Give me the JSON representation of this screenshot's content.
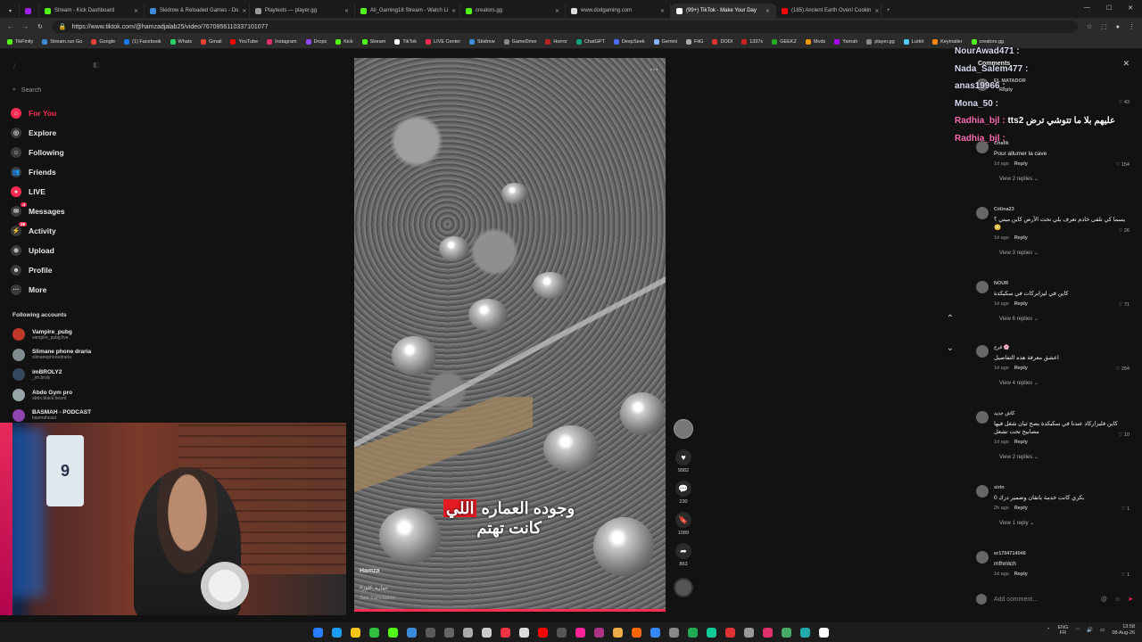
{
  "browser": {
    "tabs": [
      {
        "title": "Stream - Kick Dashboard",
        "color": "#53fc18",
        "active": false
      },
      {
        "title": "Skidrow & Reloaded Games - Do",
        "color": "#3b8bd9",
        "active": false
      },
      {
        "title": "Playtests — player.gg",
        "color": "#999999",
        "active": false
      },
      {
        "title": "Ali_Gaming18 Stream - Watch Li",
        "color": "#53fc18",
        "active": false
      },
      {
        "title": "creators.gg",
        "color": "#53fc18",
        "active": false
      },
      {
        "title": "www.dodgaming.com",
        "color": "#dddddd",
        "active": false
      },
      {
        "title": "(99+) TikTok - Make Your Day",
        "color": "#ffffff",
        "active": true
      },
      {
        "title": "(185) Ancient Earth Oven! Cookin",
        "color": "#ff0000",
        "active": false
      }
    ],
    "url": "https://www.tiktok.com/@hamzadjalab25/video/7670956110337101077",
    "bookmarks": [
      "TikFinity",
      "Stream.run Go",
      "Google",
      "(1) Facebook",
      "Whats",
      "Gmail",
      "YouTube",
      "Instagram",
      "Drops",
      "Kick",
      "Stream",
      "TikTok",
      "LIVE Center",
      "Skidrow",
      "GameDrive",
      "Horror",
      "ChatGPT",
      "DeepSeek",
      "Gemini",
      "FitG",
      "DODI",
      "1337x",
      "GEEKZ",
      "Mods",
      "Yamah",
      "player.gg",
      "Lurkit",
      "Keymailer",
      "creators.gg"
    ],
    "window_controls": [
      "—",
      "☐",
      "✕"
    ]
  },
  "sidebar": {
    "search_placeholder": "Search",
    "nav": [
      {
        "label": "For You",
        "icon": "home-icon",
        "glyph": "⌂",
        "active": true,
        "badge": ""
      },
      {
        "label": "Explore",
        "icon": "compass-icon",
        "glyph": "◎",
        "active": false,
        "badge": ""
      },
      {
        "label": "Following",
        "icon": "following-icon",
        "glyph": "☺",
        "active": false,
        "badge": ""
      },
      {
        "label": "Friends",
        "icon": "friends-icon",
        "glyph": "👥",
        "active": false,
        "badge": ""
      },
      {
        "label": "LIVE",
        "icon": "live-icon",
        "glyph": "●",
        "active": false,
        "badge": ""
      },
      {
        "label": "Messages",
        "icon": "messages-icon",
        "glyph": "✉",
        "active": false,
        "badge": "4"
      },
      {
        "label": "Activity",
        "icon": "activity-icon",
        "glyph": "⚡",
        "active": false,
        "badge": "28"
      },
      {
        "label": "Upload",
        "icon": "upload-icon",
        "glyph": "⊕",
        "active": false,
        "badge": ""
      },
      {
        "label": "Profile",
        "icon": "profile-icon",
        "glyph": "☻",
        "active": false,
        "badge": ""
      },
      {
        "label": "More",
        "icon": "more-icon",
        "glyph": "···",
        "active": false,
        "badge": ""
      }
    ],
    "following_title": "Following accounts",
    "following": [
      {
        "name": "Vampire_pubg",
        "handle": "vampire_pubg.live"
      },
      {
        "name": "Slimane phone draria",
        "handle": "slimanephonedraria"
      },
      {
        "name": "imBROLY2",
        "handle": "_im.broly"
      },
      {
        "name": "Abdo Gym pro",
        "handle": "abdo.black.beard"
      },
      {
        "name": "BASMAH - PODCAST",
        "handle": "basmahcast"
      }
    ]
  },
  "video": {
    "caption_line1_plain": "وجوده العماره",
    "caption_line1_highlight": "اللي",
    "caption_line2": "كانت تهتم",
    "author": "Hamza",
    "tag": "#عمارة_كلوز",
    "see_translation": "See translation",
    "progress": 1.0
  },
  "actions": {
    "likes": "9982",
    "comments": "230",
    "saves": "1089",
    "shares": "863"
  },
  "comments": {
    "title": "Comments",
    "items": [
      {
        "user": "EL MATADOR",
        "text": "",
        "time": "",
        "reply": "Reply",
        "likes": "43",
        "more": ""
      },
      {
        "user": "Chafik",
        "text": "Pour allumer la cave",
        "time": "1d ago",
        "reply": "Reply",
        "likes": "154",
        "more": "View 2 replies"
      },
      {
        "user": "Célina23",
        "text": "يسما كي تلقى خادم تعرف بلي تحت الأرض كاين مبني ؟ 😳",
        "time": "1d ago",
        "reply": "Reply",
        "likes": "26",
        "more": "View 3 replies"
      },
      {
        "user": "NOUR",
        "text": "كاين في ليزابركات في سكيكدة",
        "time": "1d ago",
        "reply": "Reply",
        "likes": "71",
        "more": "View 6 replies"
      },
      {
        "user": "فرح 🌸",
        "text": "اعشق معرفة هذه التفاصيل",
        "time": "1d ago",
        "reply": "Reply",
        "likes": "284",
        "more": "View 4 replies"
      },
      {
        "user": "كاش جديد",
        "text": "كاين فليزاركاد عندنا في سكيكدة بصح ثيان شغل فيها مصابيح تحت تشعل",
        "time": "1d ago",
        "reply": "Reply",
        "likes": "10",
        "more": "View 2 replies"
      },
      {
        "user": "sirin",
        "text": "بكري كانت خدمة باتقان وضمير دزك 0",
        "time": "2h ago",
        "reply": "Reply",
        "likes": "1",
        "more": "View 1 reply"
      },
      {
        "user": "er1704714046",
        "text": "mfhmtch",
        "time": "1d ago",
        "reply": "Reply",
        "likes": "1",
        "more": ""
      }
    ],
    "input_placeholder": "Add comment..."
  },
  "stream_chat": [
    {
      "user": "NourAwad471",
      "msg": "",
      "color": "#d8dcf0"
    },
    {
      "user": "Nada_Salem477",
      "msg": "",
      "color": "#d8dcf0"
    },
    {
      "user": "anas19966",
      "msg": "",
      "color": "#d8dcf0"
    },
    {
      "user": "Mona_50",
      "msg": "",
      "color": "#d8dcf0"
    },
    {
      "user": "Radhia_bjl",
      "msg": "tts2 عليهم بلا ما تتوشي ترض",
      "color": "#ff6eb4"
    },
    {
      "user": "Radhia_bjl",
      "msg": "",
      "color": "#ff6eb4"
    }
  ],
  "taskbar": {
    "lang": "ENG",
    "lang2": "FR",
    "time": "13:58",
    "date": "08-Aug-26"
  },
  "webcam": {
    "jersey_number": "9"
  },
  "colors": {
    "accent": "#fe2c55",
    "background": "#121212"
  }
}
